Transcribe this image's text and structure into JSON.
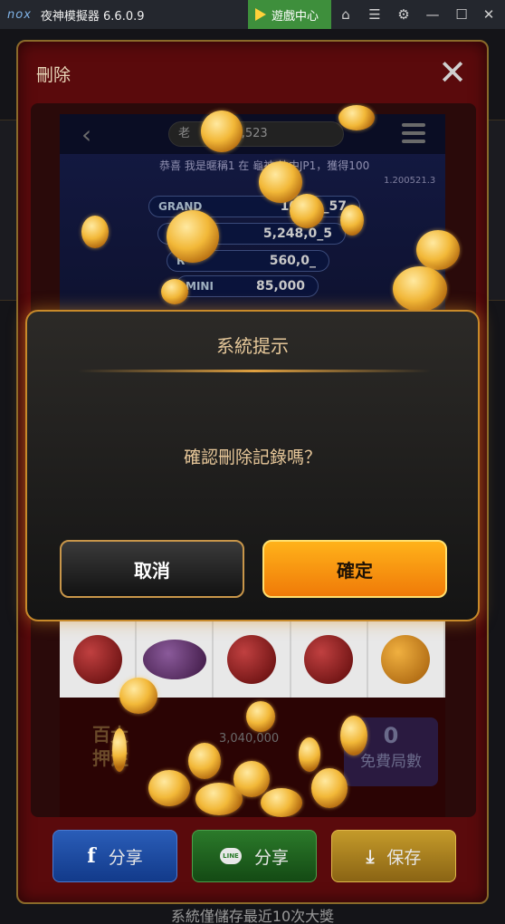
{
  "titlebar": {
    "logo": "nox",
    "app_title": "夜神模擬器 6.6.0.9",
    "game_center": "遊戲中心",
    "icons": [
      "shirt-icon",
      "menu-icon",
      "gear-icon",
      "minimize-icon",
      "maximize-icon",
      "close-icon"
    ]
  },
  "panel": {
    "title": "刪除",
    "close_glyph": "✕"
  },
  "game_preview": {
    "coin_balance": "52,523",
    "coin_prefix": "老",
    "marquee": "恭喜 我是暱稱1 在  龜神 拉中JP1，獲得100",
    "version": "1.200521.3",
    "jackpots": [
      {
        "label": "GRAND",
        "value": "10,1_,_57"
      },
      {
        "label": "",
        "value": "5,248,0_5"
      },
      {
        "label": "R",
        "value": "560,0_"
      },
      {
        "label": "MINI",
        "value": "85,000"
      }
    ],
    "bet_label": "百大\n押注",
    "win_amount": "3,040,000",
    "free_count": "0",
    "free_label": "免費局數"
  },
  "dialog": {
    "title": "系統提示",
    "message": "確認刪除記錄嗎？",
    "cancel_label": "取消",
    "ok_label": "確定"
  },
  "share": {
    "facebook_label": "分享",
    "line_label": "分享",
    "save_label": "保存",
    "line_icon_text": "LINE"
  },
  "footer": {
    "note": "系統僅儲存最近10次大獎"
  },
  "colors": {
    "panel_red": "#5a0a0c",
    "dialog_gold": "#c88a2a",
    "ok_orange": "#f59a10"
  }
}
